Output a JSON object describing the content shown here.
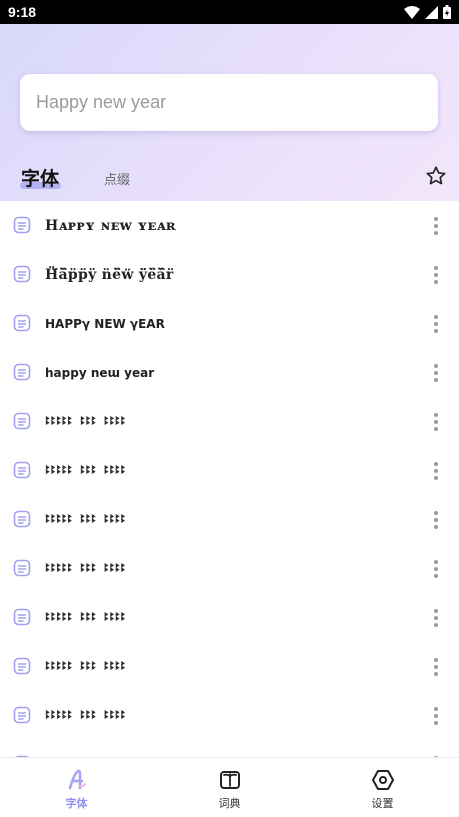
{
  "status_bar": {
    "time": "9:18"
  },
  "search": {
    "value": "Happy new year"
  },
  "tabs": {
    "active": "字体",
    "inactive": "点缀"
  },
  "rows": [
    {
      "text": "Hᴀᴘᴘʏ ɴᴇᴡ ʏᴇᴀʀ",
      "style": "bold"
    },
    {
      "text": "Ḧ̈ä̈p̈p̈ÿ n̈ë̈ẅ ÿ̈ë̈ä̈r̈",
      "style": "bold"
    },
    {
      "text": "HAPPγ NEW γEAR",
      "style": "curly"
    },
    {
      "text": "happy neɯ year",
      "style": "curly"
    },
    {
      "text": "ꔪꔪꔪꔪꔪ ꔪꔪꔪ ꔪꔪꔪꔪ",
      "style": "mono"
    },
    {
      "text": "ꔪꔪꔪꔪꔪ ꔪꔪꔪ ꔪꔪꔪꔪ",
      "style": "mono"
    },
    {
      "text": "ꔪꔪꔪꔪꔪ ꔪꔪꔪ ꔪꔪꔪꔪ",
      "style": "mono"
    },
    {
      "text": "ꔪꔪꔪꔪꔪ ꔪꔪꔪ ꔪꔪꔪꔪ",
      "style": "mono"
    },
    {
      "text": "ꔪꔪꔪꔪꔪ ꔪꔪꔪ ꔪꔪꔪꔪ",
      "style": "mono"
    },
    {
      "text": "ꔪꔪꔪꔪꔪ ꔪꔪꔪ ꔪꔪꔪꔪ",
      "style": "mono"
    },
    {
      "text": "ꔪꔪꔪꔪꔪ ꔪꔪꔪ ꔪꔪꔪꔪ",
      "style": "mono"
    },
    {
      "text": "",
      "style": "mono"
    }
  ],
  "nav": [
    {
      "label": "字体",
      "icon": "font-icon",
      "active": true
    },
    {
      "label": "词典",
      "icon": "book-icon",
      "active": false
    },
    {
      "label": "设置",
      "icon": "settings-icon",
      "active": false
    }
  ],
  "colors": {
    "accent": "#8f8ff0",
    "hero_start": "#d8d8fb",
    "hero_end": "#f2e6fb"
  }
}
